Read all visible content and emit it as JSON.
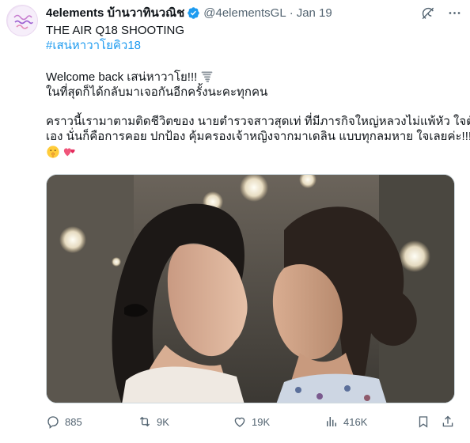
{
  "author": {
    "display_name": "4elements บ้านวาทินวณิช",
    "handle": "@4elementsGL",
    "date": "Jan 19"
  },
  "tweet": {
    "line1": "THE AIR Q18 SHOOTING",
    "hashtag": "#เสน่หาวาโยคิว18",
    "line3": "Welcome back เสน่หาวาโย!!!",
    "line4": "ในที่สุดก็ได้กลับมาเจอกันอีกครั้งนะคะทุกคน",
    "line5": "คราวนี้เรามาตามติดชีวิตของ นายตำรวจสาวสุดเท่ ที่มีภารกิจใหญ่หลวงไม่แพ้หัว ใจตัว",
    "line6": "เอง นั่นก็คือการคอย ปกป้อง คุ้มครองเจ้าหญิงจากมาเดลิน แบบทุกลมหาย ใจเลยค่ะ!!!"
  },
  "icons": {
    "verified": "verified-badge-icon",
    "grok": "grok-icon",
    "more": "more-icon",
    "tornado": "tornado-emoji",
    "shush": "shushing-face-emoji",
    "hearts": "revolving-hearts-emoji",
    "reply": "reply-icon",
    "retweet": "retweet-icon",
    "like": "like-icon",
    "views": "views-icon",
    "bookmark": "bookmark-icon",
    "share": "share-icon"
  },
  "stats": {
    "replies": "885",
    "retweets": "9K",
    "likes": "19K",
    "views": "416K"
  },
  "colors": {
    "verified": "#1d9bf0",
    "hashtag": "#1d9bf0",
    "secondary_text": "#536471"
  }
}
